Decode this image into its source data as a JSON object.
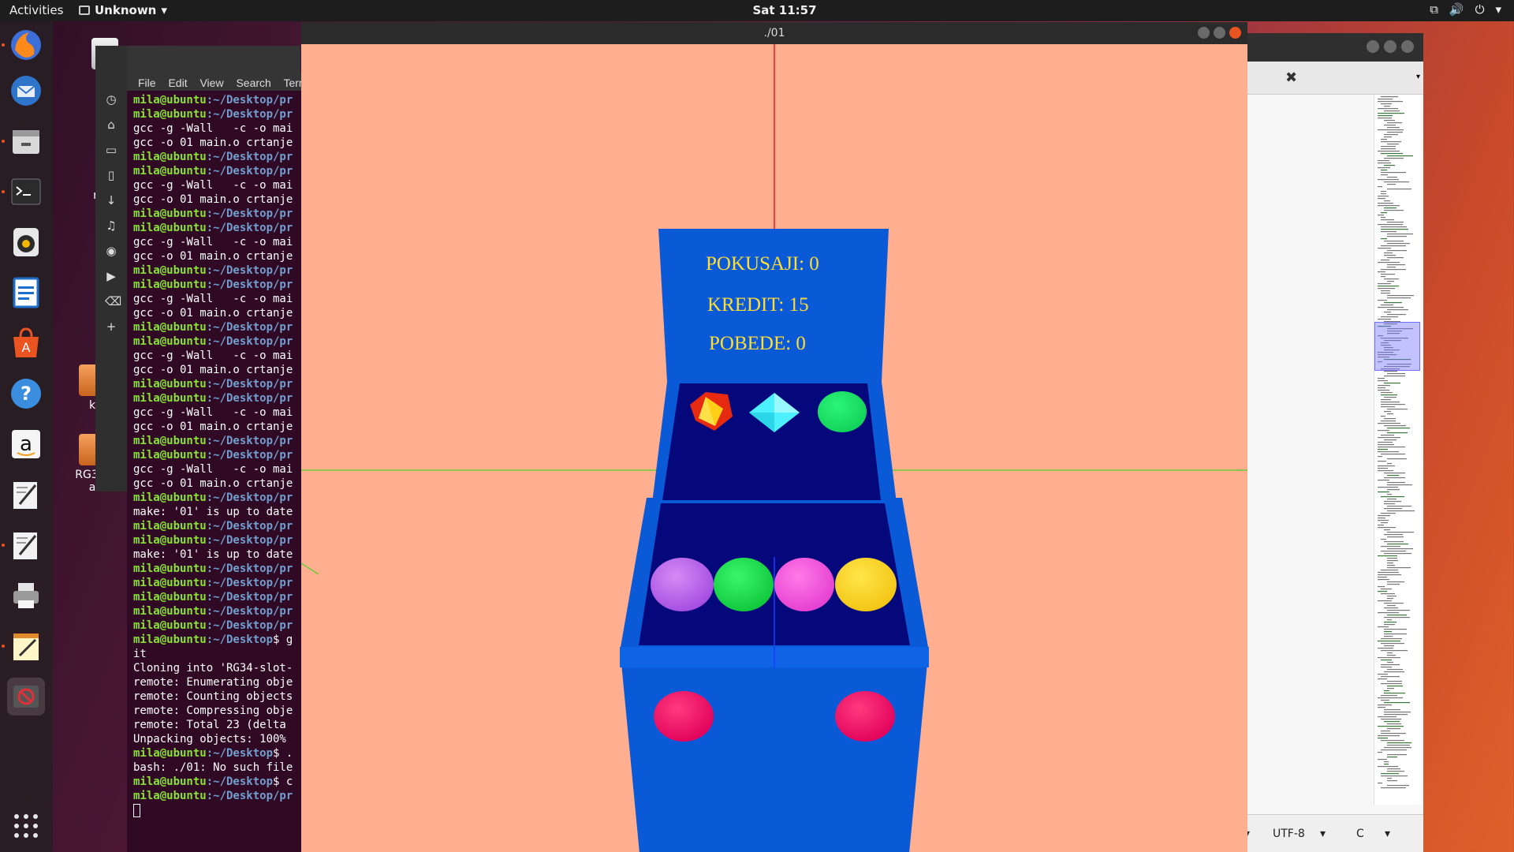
{
  "topbar": {
    "activities": "Activities",
    "app_name": "Unknown",
    "clock": "Sat 11:57"
  },
  "dock": {
    "items": [
      "firefox-icon",
      "thunderbird-icon",
      "files-icon",
      "terminal-icon",
      "rhythmbox-icon",
      "writer-icon",
      "software-icon",
      "help-icon",
      "amazon-icon",
      "text-editor-icon",
      "text-editor-icon",
      "printer-icon",
      "notes-icon",
      "blocked-app-icon",
      "show-apps-icon"
    ]
  },
  "desktop": {
    "labels": [
      "T",
      "m",
      "k",
      "RG34-",
      "a"
    ]
  },
  "terminal": {
    "menu": [
      "File",
      "Edit",
      "View",
      "Search",
      "Term"
    ],
    "lines": [
      {
        "u": "mila@ubuntu",
        "p": ":~/Desktop/pr",
        "t": ""
      },
      {
        "u": "mila@ubuntu",
        "p": ":~/Desktop/pr",
        "t": ""
      },
      {
        "u": "",
        "p": "",
        "t": "gcc -g -Wall   -c -o mai"
      },
      {
        "u": "",
        "p": "",
        "t": "gcc -o 01 main.o crtanje"
      },
      {
        "u": "mila@ubuntu",
        "p": ":~/Desktop/pr",
        "t": ""
      },
      {
        "u": "mila@ubuntu",
        "p": ":~/Desktop/pr",
        "t": ""
      },
      {
        "u": "",
        "p": "",
        "t": "gcc -g -Wall   -c -o mai"
      },
      {
        "u": "",
        "p": "",
        "t": "gcc -o 01 main.o crtanje"
      },
      {
        "u": "mila@ubuntu",
        "p": ":~/Desktop/pr",
        "t": ""
      },
      {
        "u": "mila@ubuntu",
        "p": ":~/Desktop/pr",
        "t": ""
      },
      {
        "u": "",
        "p": "",
        "t": "gcc -g -Wall   -c -o mai"
      },
      {
        "u": "",
        "p": "",
        "t": "gcc -o 01 main.o crtanje"
      },
      {
        "u": "mila@ubuntu",
        "p": ":~/Desktop/pr",
        "t": ""
      },
      {
        "u": "mila@ubuntu",
        "p": ":~/Desktop/pr",
        "t": ""
      },
      {
        "u": "",
        "p": "",
        "t": "gcc -g -Wall   -c -o mai"
      },
      {
        "u": "",
        "p": "",
        "t": "gcc -o 01 main.o crtanje"
      },
      {
        "u": "mila@ubuntu",
        "p": ":~/Desktop/pr",
        "t": ""
      },
      {
        "u": "mila@ubuntu",
        "p": ":~/Desktop/pr",
        "t": ""
      },
      {
        "u": "",
        "p": "",
        "t": "gcc -g -Wall   -c -o mai"
      },
      {
        "u": "",
        "p": "",
        "t": "gcc -o 01 main.o crtanje"
      },
      {
        "u": "mila@ubuntu",
        "p": ":~/Desktop/pr",
        "t": ""
      },
      {
        "u": "mila@ubuntu",
        "p": ":~/Desktop/pr",
        "t": ""
      },
      {
        "u": "",
        "p": "",
        "t": "gcc -g -Wall   -c -o mai"
      },
      {
        "u": "",
        "p": "",
        "t": "gcc -o 01 main.o crtanje"
      },
      {
        "u": "mila@ubuntu",
        "p": ":~/Desktop/pr",
        "t": ""
      },
      {
        "u": "mila@ubuntu",
        "p": ":~/Desktop/pr",
        "t": ""
      },
      {
        "u": "",
        "p": "",
        "t": "gcc -g -Wall   -c -o mai"
      },
      {
        "u": "",
        "p": "",
        "t": "gcc -o 01 main.o crtanje"
      },
      {
        "u": "mila@ubuntu",
        "p": ":~/Desktop/pr",
        "t": ""
      },
      {
        "u": "",
        "p": "",
        "t": "make: '01' is up to date"
      },
      {
        "u": "mila@ubuntu",
        "p": ":~/Desktop/pr",
        "t": ""
      },
      {
        "u": "mila@ubuntu",
        "p": ":~/Desktop/pr",
        "t": ""
      },
      {
        "u": "",
        "p": "",
        "t": "make: '01' is up to date"
      },
      {
        "u": "mila@ubuntu",
        "p": ":~/Desktop/pr",
        "t": ""
      },
      {
        "u": "mila@ubuntu",
        "p": ":~/Desktop/pr",
        "t": ""
      },
      {
        "u": "mila@ubuntu",
        "p": ":~/Desktop/pr",
        "t": ""
      },
      {
        "u": "mila@ubuntu",
        "p": ":~/Desktop/pr",
        "t": ""
      },
      {
        "u": "mila@ubuntu",
        "p": ":~/Desktop/pr",
        "t": ""
      },
      {
        "u": "mila@ubuntu",
        "p": ":~/Desktop",
        "t": "$ g"
      },
      {
        "u": "",
        "p": "",
        "t": "it"
      },
      {
        "u": "",
        "p": "",
        "t": "Cloning into 'RG34-slot-"
      },
      {
        "u": "",
        "p": "",
        "t": "remote: Enumerating obje"
      },
      {
        "u": "",
        "p": "",
        "t": "remote: Counting objects"
      },
      {
        "u": "",
        "p": "",
        "t": "remote: Compressing obje"
      },
      {
        "u": "",
        "p": "",
        "t": "remote: Total 23 (delta "
      },
      {
        "u": "",
        "p": "",
        "t": "Unpacking objects: 100% "
      },
      {
        "u": "mila@ubuntu",
        "p": ":~/Desktop",
        "t": "$ ."
      },
      {
        "u": "",
        "p": "",
        "t": "bash: ./01: No such file"
      },
      {
        "u": "mila@ubuntu",
        "p": ":~/Desktop",
        "t": "$ c"
      },
      {
        "u": "mila@ubuntu",
        "p": ":~/Desktop/pr",
        "t": ""
      }
    ]
  },
  "gl_window": {
    "title": "./01",
    "hud": {
      "pokusaji": "POKUSAJI: 0",
      "kredit": "KREDIT: 15",
      "pobede": "POBEDE: 0"
    },
    "colors": {
      "background": "#ffaf8f",
      "cabinet": "#0a5ad8",
      "panel": "#05087a",
      "hud_text": "#ffdd33"
    }
  },
  "gedit": {
    "encoding": "UTF-8",
    "language": "C",
    "tab_close": "✖"
  }
}
